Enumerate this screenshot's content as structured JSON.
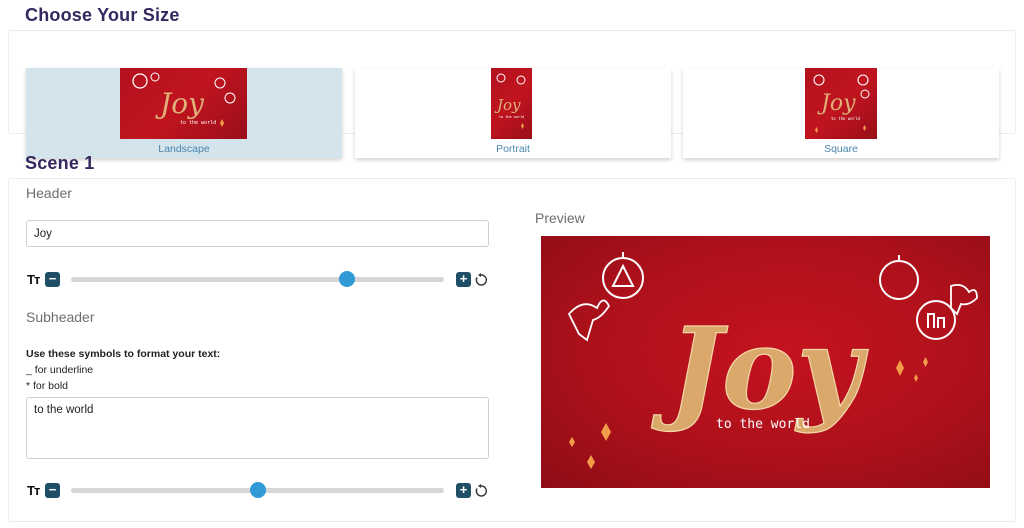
{
  "size_section": {
    "title": "Choose Your Size",
    "options": [
      {
        "label": "Landscape",
        "selected": true
      },
      {
        "label": "Portrait",
        "selected": false
      },
      {
        "label": "Square",
        "selected": false
      }
    ]
  },
  "scene": {
    "title": "Scene 1",
    "header": {
      "label": "Header",
      "value": "Joy",
      "font_size_level": 0.74
    },
    "subheader": {
      "label": "Subheader",
      "hint_title": "Use these symbols to format your text:",
      "hint_underline": "_ for underline",
      "hint_bold": "* for bold",
      "value": "to the world",
      "font_size_level": 0.5
    },
    "font_icon_text": "Tт",
    "minus_label": "−",
    "plus_label": "+"
  },
  "preview": {
    "label": "Preview",
    "headline": "Joy",
    "subline": "to the world"
  },
  "colors": {
    "heading": "#35275f",
    "accent_blue": "#2f9ad5",
    "button_dark": "#1e4f66",
    "card_red": "#b3121e",
    "gold": "#d9a86a",
    "selected_card": "#d3e4ec"
  }
}
